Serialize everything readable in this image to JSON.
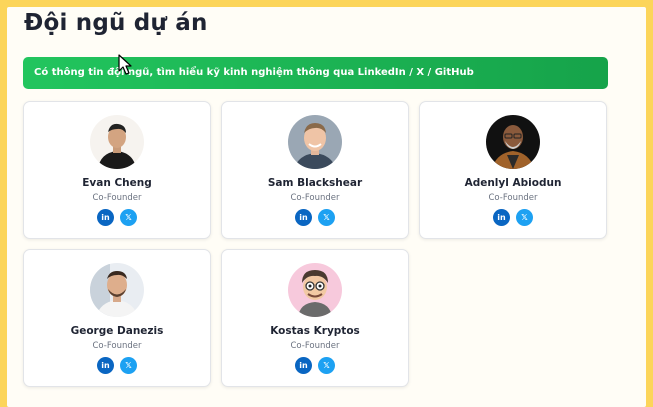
{
  "page": {
    "title": "Đội ngũ dự án",
    "banner": "Có thông tin đội ngũ, tìm hiểu kỹ kinh nghiệm thông qua LinkedIn / X / GitHub"
  },
  "colors": {
    "frame": "#fcd55a",
    "banner_start": "#22c55e",
    "banner_end": "#16a34a",
    "linkedin": "#0a66c2",
    "x": "#1da1f2"
  },
  "members": [
    {
      "name": "Evan Cheng",
      "role": "Co-Founder",
      "linkedin_icon": "in",
      "x_icon": "𝕏",
      "avatar": "photo-man-black-shirt"
    },
    {
      "name": "Sam Blackshear",
      "role": "Co-Founder",
      "linkedin_icon": "in",
      "x_icon": "𝕏",
      "avatar": "photo-man-smiling"
    },
    {
      "name": "Adenlyl Abiodun",
      "role": "Co-Founder",
      "linkedin_icon": "in",
      "x_icon": "𝕏",
      "avatar": "photo-man-glasses-beard"
    },
    {
      "name": "George Danezis",
      "role": "Co-Founder",
      "linkedin_icon": "in",
      "x_icon": "𝕏",
      "avatar": "photo-man-beard"
    },
    {
      "name": "Kostas Kryptos",
      "role": "Co-Founder",
      "linkedin_icon": "in",
      "x_icon": "𝕏",
      "avatar": "cartoon-avatar-glasses"
    }
  ]
}
